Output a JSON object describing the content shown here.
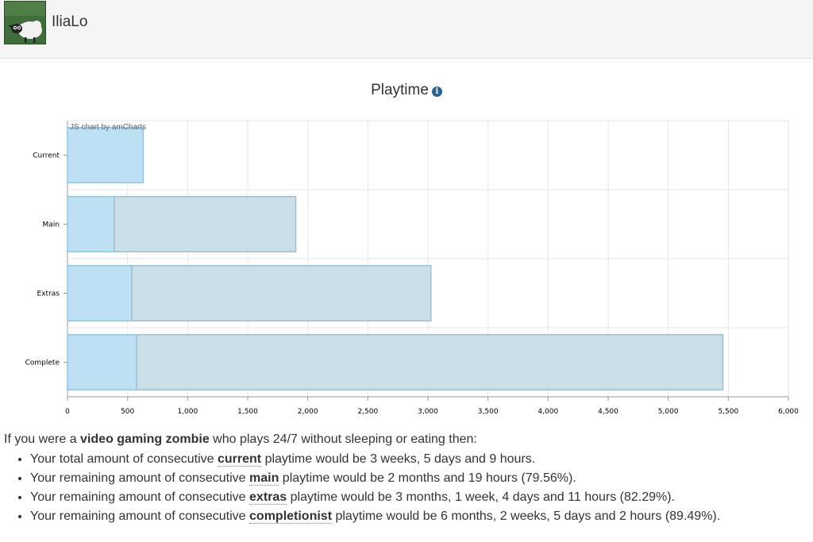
{
  "header": {
    "username": "IliaLo",
    "avatar": "sheep-avatar-icon"
  },
  "chart": {
    "title": "Playtime",
    "info_icon": "info-icon",
    "credit": "JS chart by amCharts"
  },
  "chart_data": {
    "type": "bar",
    "orientation": "horizontal",
    "stacked": true,
    "categories": [
      "Current",
      "Main",
      "Extras",
      "Complete"
    ],
    "series": [
      {
        "values": [
          630,
          390,
          535,
          575
        ],
        "color": "#bde0f5"
      },
      {
        "values": [
          0,
          1510,
          2490,
          4880
        ],
        "color": "#cadfe8"
      }
    ],
    "xlim": [
      0,
      6000
    ],
    "x_ticks": [
      "0",
      "500",
      "1,000",
      "1,500",
      "2,000",
      "2,500",
      "3,000",
      "3,500",
      "4,000",
      "4,500",
      "5,000",
      "5,500",
      "6,000"
    ],
    "grid": true
  },
  "summary": {
    "pre": "If you were a ",
    "bold": "video gaming zombie",
    "post": " who plays 24/7 without sleeping or eating then:"
  },
  "stats": [
    {
      "pre": "Your total amount of consecutive ",
      "kw": "current",
      "post": " playtime would be 3 weeks, 5 days and 9 hours."
    },
    {
      "pre": "Your remaining amount of consecutive ",
      "kw": "main",
      "post": " playtime would be 2 months and 19 hours (79.56%)."
    },
    {
      "pre": "Your remaining amount of consecutive ",
      "kw": "extras",
      "post": " playtime would be 3 months, 1 week, 4 days and 11 hours (82.29%)."
    },
    {
      "pre": "Your remaining amount of consecutive ",
      "kw": "completionist",
      "post": " playtime would be 6 months, 2 weeks, 5 days and 2 hours (89.49%)."
    }
  ]
}
